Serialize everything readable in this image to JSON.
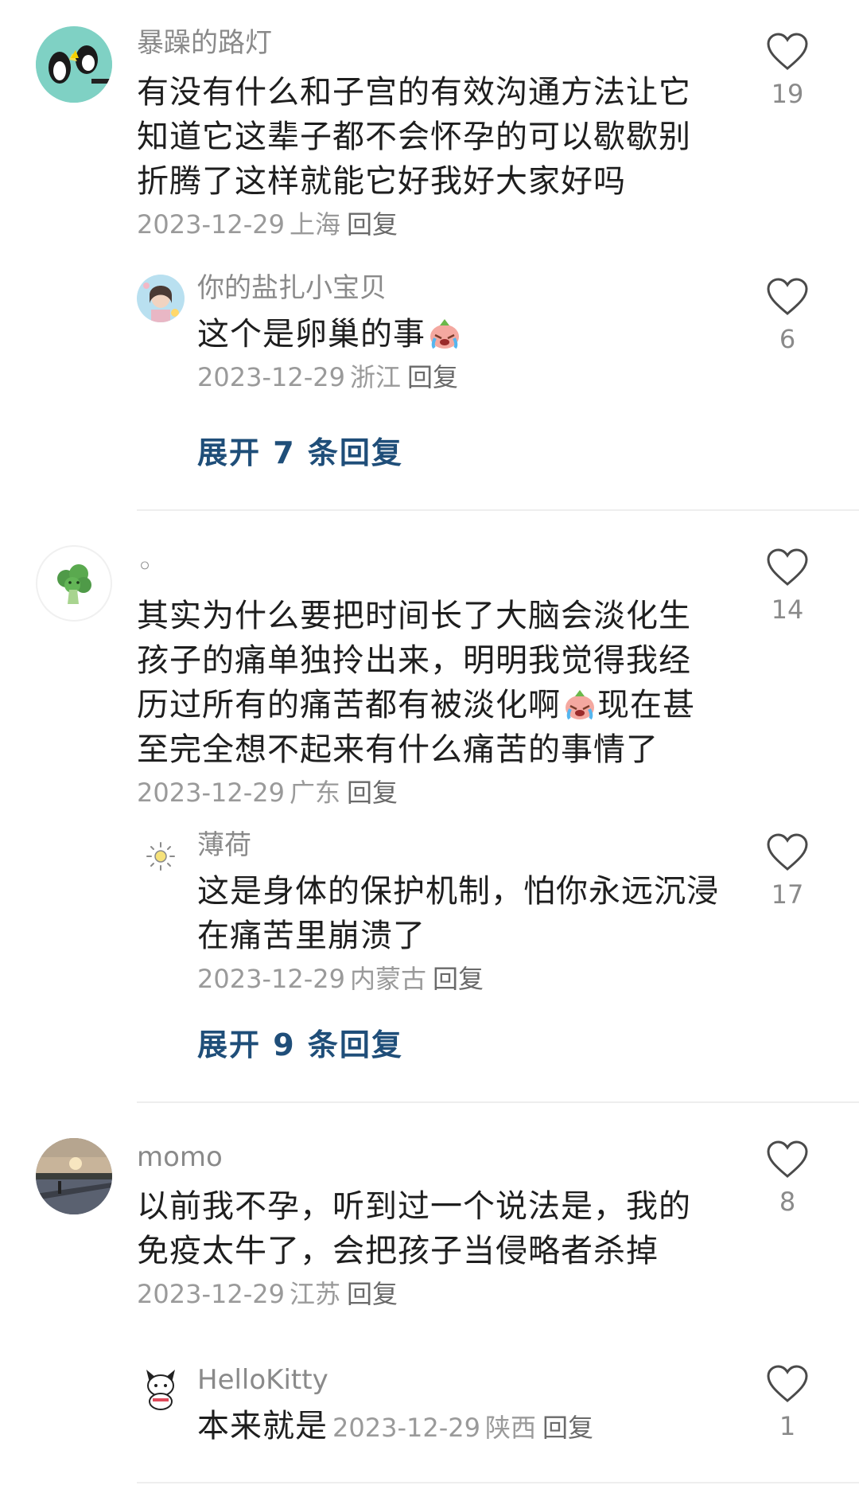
{
  "comments": [
    {
      "username": "暴躁的路灯",
      "lines": [
        "有没有什么和子宫的有效沟通方法让它",
        "知道它这辈子都不会怀孕的可以歇歇别",
        "折腾了这样就能它好我好大家好吗"
      ],
      "date": "2023-12-29",
      "location": "上海",
      "reply_label": "回复",
      "likes": "19",
      "avatar_icon": "penguin-cartoon-icon",
      "replies": [
        {
          "username": "你的盐扎小宝贝",
          "text": "这个是卵巢的事",
          "emoji": "crying-emoji-icon",
          "date": "2023-12-29",
          "location": "浙江",
          "reply_label": "回复",
          "likes": "6"
        }
      ],
      "expand_label": "展开 7 条回复"
    },
    {
      "username": "◦",
      "lines": [
        "其实为什么要把时间长了大脑会淡化生",
        "孩子的痛单独拎出来，明明我觉得我经"
      ],
      "line3_before_emoji": "历过所有的痛苦都有被淡化啊",
      "line3_after_emoji": "现在甚",
      "line4": "至完全想不起来有什么痛苦的事情了",
      "date": "2023-12-29",
      "location": "广东",
      "reply_label": "回复",
      "likes": "14",
      "avatar_icon": "broccoli-icon",
      "replies": [
        {
          "username": "薄荷",
          "lines": [
            "这是身体的保护机制，怕你永远沉浸",
            "在痛苦里崩溃了"
          ],
          "date": "2023-12-29",
          "location": "内蒙古",
          "reply_label": "回复",
          "likes": "17",
          "avatar_icon": "sun-icon"
        }
      ],
      "expand_label": "展开 9 条回复"
    },
    {
      "username": "momo",
      "lines": [
        "以前我不孕，听到过一个说法是，我的",
        "免疫太牛了，会把孩子当侵略者杀掉"
      ],
      "date": "2023-12-29",
      "location": "江苏",
      "reply_label": "回复",
      "likes": "8",
      "avatar_icon": "sunset-photo-icon",
      "replies": [
        {
          "username": "HelloKitty",
          "text": "本来就是",
          "date": "2023-12-29",
          "location": "陕西",
          "reply_label": "回复",
          "likes": "1",
          "avatar_icon": "cartoon-character-icon"
        }
      ]
    }
  ],
  "colors": {
    "expand_link": "#1f4e79",
    "username": "#8a8a8a",
    "meta": "#9a9a9a",
    "divider": "#eeeeee"
  }
}
